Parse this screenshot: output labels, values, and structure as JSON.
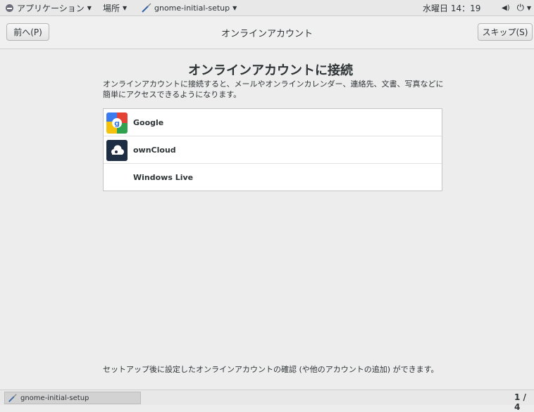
{
  "top_panel": {
    "applications": "アプリケーション",
    "places": "場所",
    "window_name": "gnome-initial-setup",
    "clock": "水曜日 14：19"
  },
  "header": {
    "back_label": "前へ(P)",
    "title": "オンラインアカウント",
    "skip_label": "スキップ(S)"
  },
  "content": {
    "title": "オンラインアカウントに接続",
    "description": "オンラインアカウントに接続すると、メールやオンラインカレンダー、連絡先、文書、写真などに簡単にアクセスできるようになります。",
    "providers": [
      {
        "name": "Google",
        "icon": "google-icon"
      },
      {
        "name": "ownCloud",
        "icon": "owncloud-icon"
      },
      {
        "name": "Windows Live",
        "icon": ""
      }
    ],
    "footer_note": "セットアップ後に設定したオンラインアカウントの確認 (や他のアカウントの追加) ができます。"
  },
  "bottom_panel": {
    "task_label": "gnome-initial-setup",
    "workspace": "1 / 4"
  }
}
